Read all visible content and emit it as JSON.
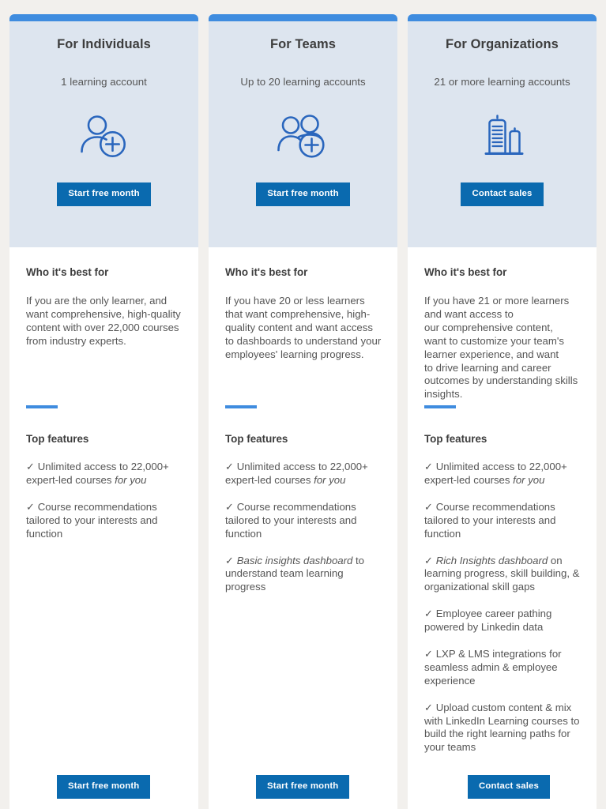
{
  "theme": {
    "page_background": "#f2f0ed",
    "card_background": "#ffffff",
    "card_header_background": "#dde5ef",
    "accent_blue": "#3f8cdf",
    "button_blue": "#0a6aaf",
    "heading_color": "#3d3d3d",
    "body_color": "#555555"
  },
  "section_labels": {
    "who": "Who it's best for",
    "features": "Top features"
  },
  "cards": [
    {
      "title": "For Individuals",
      "subtitle": "1 learning account",
      "icon": "person-plus-icon",
      "cta_top": "Start free month",
      "cta_bottom": "Start free month",
      "who_heading": "Who it's best for",
      "who_text": "If you are the only learner, and want comprehensive, high-quality content with over 22,000 courses from industry experts.",
      "features_heading": "Top features",
      "features": [
        {
          "check": "✓",
          "pre": "Unlimited access to 22,000+ expert-led courses ",
          "em": "for you",
          "post": ""
        },
        {
          "check": "✓",
          "pre": "Course recommendations tailored to your interests and function",
          "em": "",
          "post": ""
        }
      ]
    },
    {
      "title": "For Teams",
      "subtitle": "Up to 20 learning accounts",
      "icon": "people-plus-icon",
      "cta_top": "Start free month",
      "cta_bottom": "Start free month",
      "who_heading": "Who it's best for",
      "who_text": "If you have 20 or less learners that want comprehensive, high-quality content and want access to dashboards to understand your employees' learning progress.",
      "features_heading": "Top features",
      "features": [
        {
          "check": "✓",
          "pre": "Unlimited access to 22,000+ expert-led courses ",
          "em": "for you",
          "post": ""
        },
        {
          "check": "✓",
          "pre": "Course recommendations tailored to your interests and function",
          "em": "",
          "post": ""
        },
        {
          "check": "✓",
          "pre": "",
          "em": "Basic insights dashboard",
          "post": " to understand team learning progress"
        }
      ]
    },
    {
      "title": "For Organizations",
      "subtitle": "21 or more learning accounts",
      "icon": "buildings-icon",
      "cta_top": "Contact sales",
      "cta_bottom": "Contact sales",
      "who_heading": "Who it's best for",
      "who_text": "If you have 21 or more learners\nand want access to\nour comprehensive content,\nwant  to customize your team's\nlearner experience, and want\nto drive learning and career\noutcomes by understanding skills\ninsights.",
      "features_heading": "Top features",
      "features": [
        {
          "check": "✓",
          "pre": "Unlimited access to 22,000+ expert-led courses ",
          "em": "for you",
          "post": ""
        },
        {
          "check": "✓",
          "pre": "Course recommendations tailored to your interests and function",
          "em": "",
          "post": ""
        },
        {
          "check": "✓",
          "pre": "",
          "em": "Rich Insights dashboard",
          "post": " on learning progress, skill building, & organizational skill gaps"
        },
        {
          "check": "✓",
          "pre": "Employee career pathing powered by Linkedin data",
          "em": "",
          "post": ""
        },
        {
          "check": "✓",
          "pre": "LXP & LMS integrations for seamless admin & employee experience",
          "em": "",
          "post": ""
        },
        {
          "check": "✓",
          "pre": "Upload custom content & mix with LinkedIn Learning courses to build the right learning paths for your teams",
          "em": "",
          "post": ""
        }
      ]
    }
  ]
}
